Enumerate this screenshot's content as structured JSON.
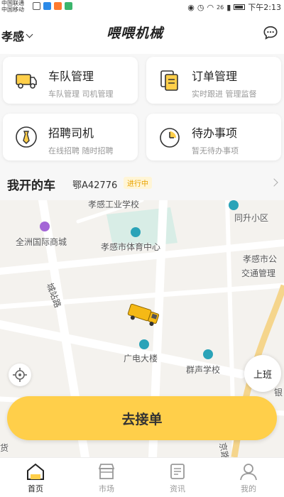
{
  "status_bar": {
    "carrier_line1": "中国联通",
    "carrier_line2": "中国移动",
    "signal": "26",
    "time": "下午2:13"
  },
  "header": {
    "city": "孝感",
    "brand": "喂喂机械"
  },
  "cards": [
    {
      "title": "车队管理",
      "sub": "车队管理 司机管理",
      "icon": "truck-icon"
    },
    {
      "title": "订单管理",
      "sub": "实时跟进 管理监督",
      "icon": "document-icon"
    },
    {
      "title": "招聘司机",
      "sub": "在线招聘 随时招聘",
      "icon": "tie-icon"
    },
    {
      "title": "待办事项",
      "sub": "暂无待办事项",
      "icon": "clock-icon"
    }
  ],
  "my_car": {
    "label": "我开的车",
    "plate": "鄂A42776",
    "status": "进行中"
  },
  "map": {
    "labels": [
      "孝感工业学校",
      "同升小区",
      "全洲国际商城",
      "孝感市体育中心",
      "孝感市公",
      "交通管理",
      "城站路",
      "广电大楼",
      "群声学校",
      "银",
      "京路",
      "货"
    ]
  },
  "buttons": {
    "shangban": "上班",
    "go": "去接单"
  },
  "tabs": [
    {
      "label": "首页",
      "active": true
    },
    {
      "label": "市场",
      "active": false
    },
    {
      "label": "资讯",
      "active": false
    },
    {
      "label": "我的",
      "active": false
    }
  ],
  "colors": {
    "accent": "#ffcf4a",
    "badge_text": "#e8a200"
  }
}
